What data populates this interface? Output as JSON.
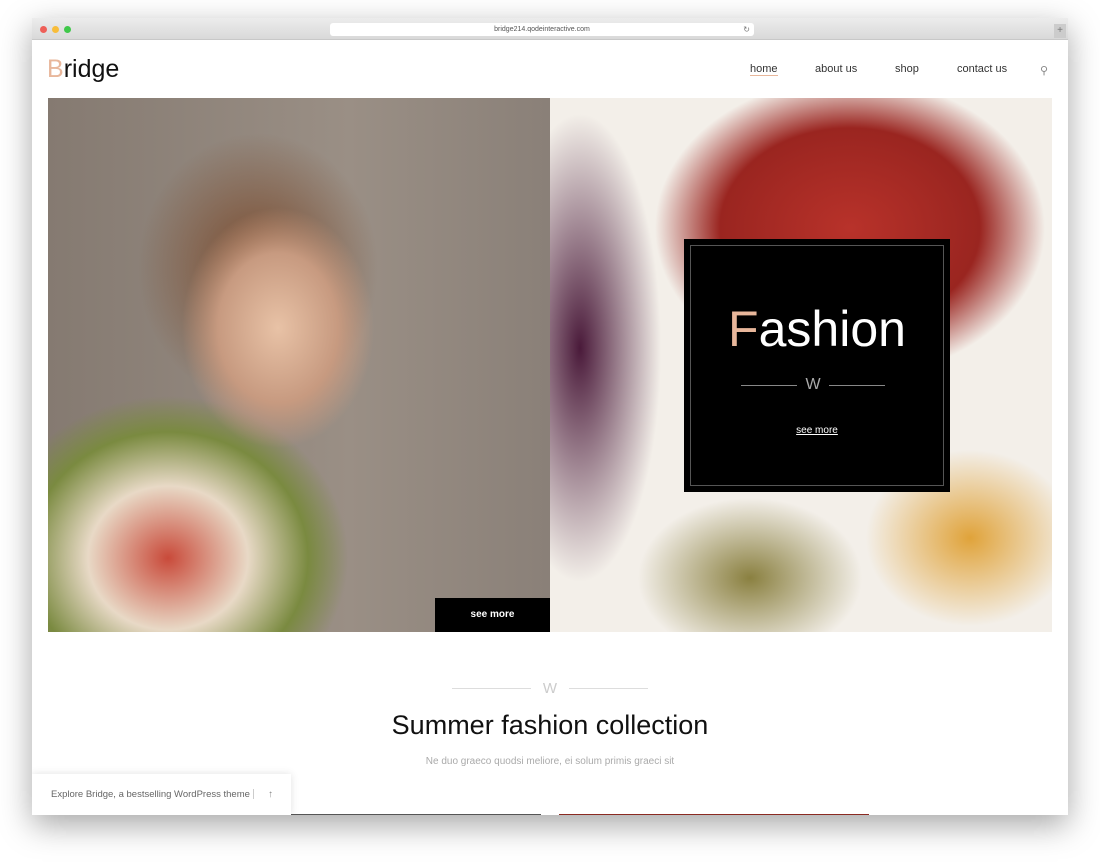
{
  "browser": {
    "url": "bridge214.qodeinteractive.com"
  },
  "header": {
    "logo_first": "B",
    "logo_rest": "ridge",
    "nav": [
      {
        "label": "home",
        "active": true
      },
      {
        "label": "about us"
      },
      {
        "label": "shop"
      },
      {
        "label": "contact us"
      }
    ]
  },
  "hero": {
    "title_first": "F",
    "title_rest": "ashion",
    "separator": "W",
    "box_link": "see more",
    "button": "see more"
  },
  "section": {
    "separator": "W",
    "title": "Summer fashion collection",
    "subtitle": "Ne duo graeco quodsi meliore, ei solum primis graeci sit"
  },
  "promo": {
    "text": "Explore Bridge, a bestselling WordPress theme",
    "arrow": "↑"
  },
  "colors": {
    "accent": "#e8b79b"
  }
}
